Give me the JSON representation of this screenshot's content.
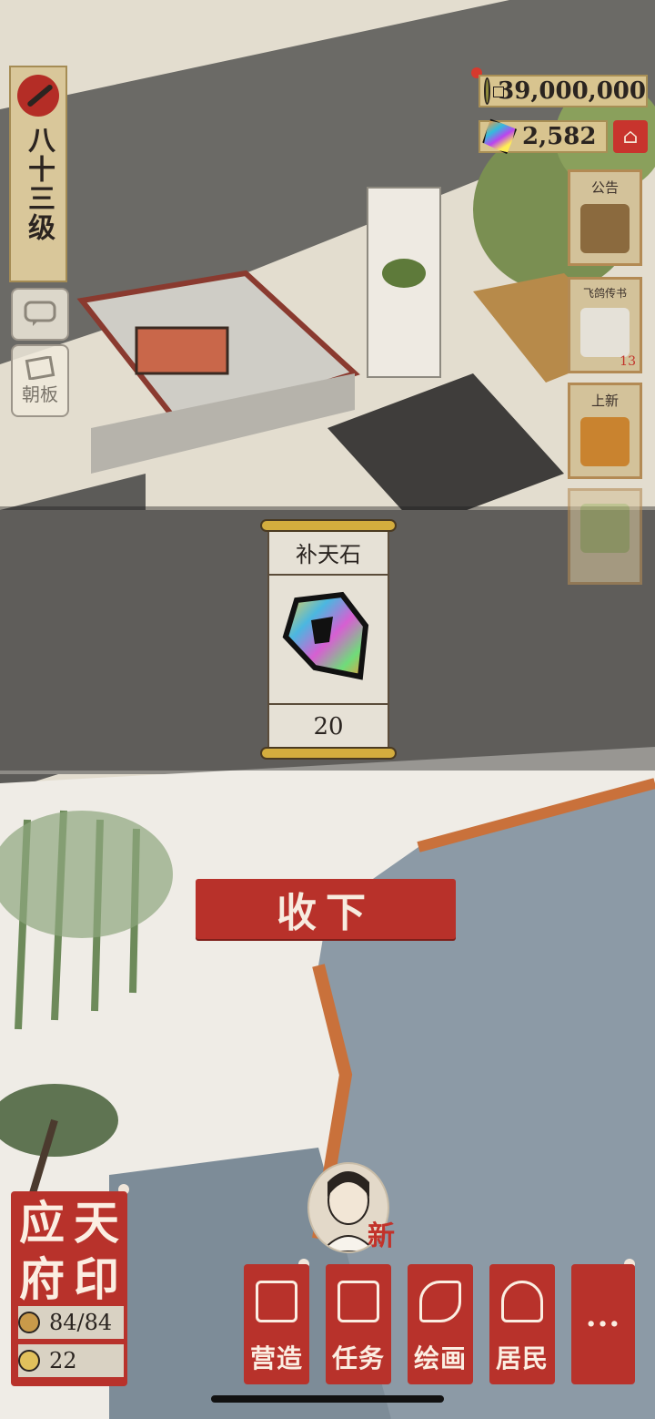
{
  "hud": {
    "level_label": "八十三级",
    "side_buttons": [
      {
        "icon": "speech-bubble-icon",
        "label": ""
      },
      {
        "icon": "court-board-icon",
        "label": "朝板"
      }
    ],
    "currency": {
      "coins": "39,000,000",
      "gems": "2,582"
    },
    "right_cards": [
      {
        "label": "公告",
        "icon": "notice-board-icon"
      },
      {
        "label": "飞鸽传书",
        "icon": "pigeon-icon",
        "badge": "13"
      },
      {
        "label": "上新",
        "icon": "new-item-icon"
      },
      {
        "label": "",
        "icon": "flower-bundle-icon"
      }
    ]
  },
  "reward": {
    "name": "补天石",
    "count": "20",
    "icon": "rainbow-stone-icon"
  },
  "accept_button": "收下",
  "city_seal": {
    "chars": [
      "应",
      "天",
      "府",
      "印"
    ],
    "population": "84/84",
    "happiness": "22"
  },
  "avatar_badge": "新",
  "bottom_nav": [
    {
      "label": "营造",
      "icon": "pavilion-icon"
    },
    {
      "label": "任务",
      "icon": "task-book-icon"
    },
    {
      "label": "绘画",
      "icon": "scroll-icon"
    },
    {
      "label": "居民",
      "icon": "resident-icon"
    },
    {
      "label": "···",
      "icon": "more-icon"
    }
  ]
}
